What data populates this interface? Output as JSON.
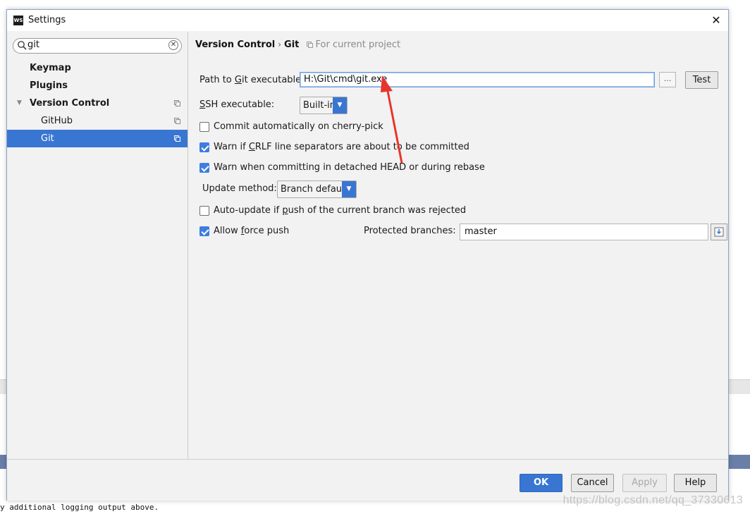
{
  "window": {
    "title": "Settings",
    "app_icon": "WS"
  },
  "sidebar": {
    "search": {
      "value": "git"
    },
    "items": [
      {
        "label": "Keymap"
      },
      {
        "label": "Plugins"
      },
      {
        "label": "Version Control",
        "expanded": true
      },
      {
        "label": "GitHub"
      },
      {
        "label": "Git",
        "selected": true
      }
    ]
  },
  "breadcrumb": {
    "parent": "Version Control",
    "separator": "›",
    "current": "Git",
    "scope": "For current project"
  },
  "git": {
    "path_label_pre": "Path to ",
    "path_label_u": "G",
    "path_label_post": "it executable:",
    "path_value": "H:\\Git\\cmd\\git.exe",
    "browse_label": "...",
    "test_label": "Test",
    "ssh_label_u": "S",
    "ssh_label_post": "SH executable:",
    "ssh_value": "Built-in",
    "commit_cherry": {
      "label": "Commit automatically on cherry-pick",
      "checked": false
    },
    "warn_crlf": {
      "pre": "Warn if ",
      "u": "C",
      "post": "RLF line separators are about to be committed",
      "checked": true
    },
    "warn_detached": {
      "label": "Warn when committing in detached HEAD or during rebase",
      "checked": true
    },
    "update_method_label": "Update method:",
    "update_method_value": "Branch default",
    "auto_update": {
      "pre": "Auto-update if ",
      "u": "p",
      "post": "ush of the current branch was rejected",
      "checked": false
    },
    "allow_force_push": {
      "pre": "Allow ",
      "u": "f",
      "post": "orce push",
      "checked": true
    },
    "protected_label": "Protected branches:",
    "protected_value": "master"
  },
  "footer": {
    "ok": "OK",
    "cancel": "Cancel",
    "apply": "Apply",
    "help": "Help"
  },
  "background": {
    "log_text": "y additional logging output above.",
    "watermark": "https://blog.csdn.net/qq_37330613"
  },
  "colors": {
    "accent": "#3876d2",
    "annotation": "#e8352b",
    "checked": "#3d7ee0"
  }
}
